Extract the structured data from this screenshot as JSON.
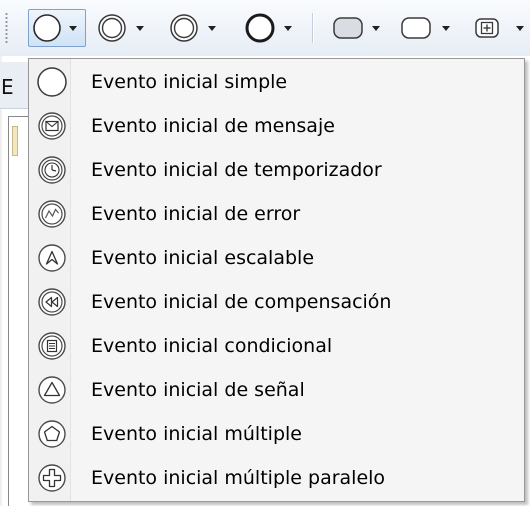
{
  "toolbar": {
    "buttons": [
      {
        "icon": "start-event-icon",
        "has_dropdown": true,
        "active": true
      },
      {
        "icon": "intermediate-event-icon",
        "has_dropdown": true
      },
      {
        "icon": "intermediate-event-icon",
        "has_dropdown": true
      },
      {
        "icon": "end-event-icon",
        "has_dropdown": true
      },
      {
        "icon": "task-icon",
        "has_dropdown": true
      },
      {
        "icon": "subprocess-icon",
        "has_dropdown": true
      },
      {
        "icon": "collapsed-subprocess-icon",
        "has_dropdown": true
      }
    ]
  },
  "background_window": {
    "tab_letter": "E"
  },
  "menu": {
    "items": [
      {
        "label": "Evento inicial simple",
        "icon": "start-event-simple-icon"
      },
      {
        "label": "Evento inicial de mensaje",
        "icon": "envelope-icon"
      },
      {
        "label": "Evento inicial de temporizador",
        "icon": "clock-icon"
      },
      {
        "label": "Evento inicial de error",
        "icon": "error-zigzag-icon"
      },
      {
        "label": "Evento inicial escalable",
        "icon": "escalation-icon"
      },
      {
        "label": "Evento inicial de compensación",
        "icon": "rewind-icon"
      },
      {
        "label": "Evento inicial condicional",
        "icon": "conditional-list-icon"
      },
      {
        "label": "Evento inicial de señal",
        "icon": "signal-triangle-icon"
      },
      {
        "label": "Evento inicial múltiple",
        "icon": "pentagon-icon"
      },
      {
        "label": "Evento inicial múltiple paralelo",
        "icon": "parallel-cross-icon"
      }
    ]
  },
  "colors": {
    "menu_background": "#f5f5f5",
    "menu_border": "#979797",
    "toolbar_active": "#cfe2f6",
    "icon_stroke": "#4a4a4a"
  }
}
